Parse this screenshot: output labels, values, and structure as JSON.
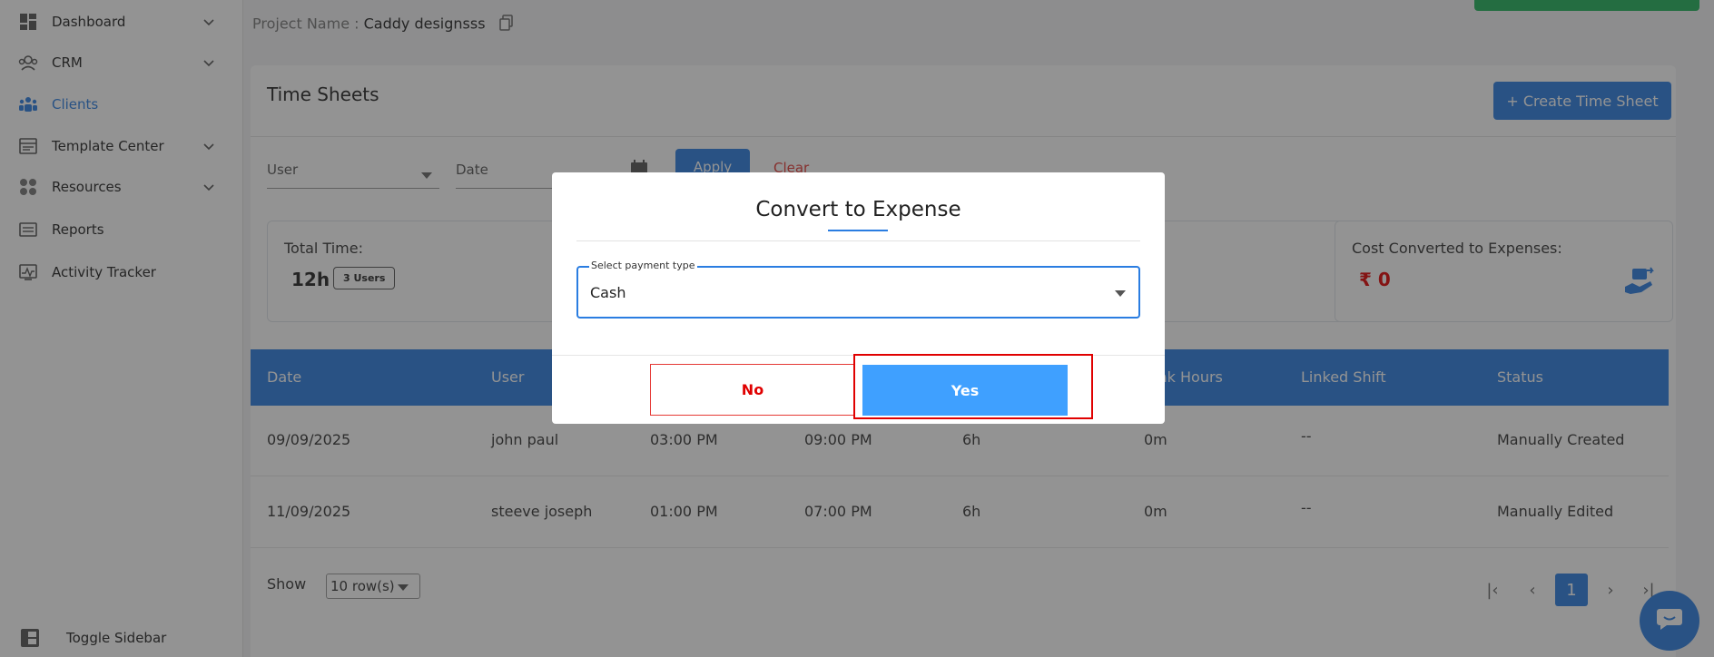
{
  "sidebar": {
    "items": [
      {
        "label": "Dashboard"
      },
      {
        "label": "CRM"
      },
      {
        "label": "Clients"
      },
      {
        "label": "Template Center"
      },
      {
        "label": "Resources"
      },
      {
        "label": "Reports"
      },
      {
        "label": "Activity Tracker"
      }
    ],
    "toggle_label": "Toggle Sidebar"
  },
  "header": {
    "project_label": "Project Name : ",
    "project_name": "Caddy designsss"
  },
  "main": {
    "title": "Time Sheets",
    "create_button": "+ Create Time Sheet",
    "filters": {
      "user_placeholder": "User",
      "date_placeholder": "Date",
      "apply": "Apply",
      "clear": "Clear"
    },
    "stats": {
      "total_time_label": "Total Time:",
      "total_time_value": "12h",
      "users_badge": "3 Users",
      "cost_label": "Cost Converted to Expenses:",
      "cost_value": "₹ 0"
    },
    "table": {
      "headers": [
        "Date",
        "User",
        "",
        "",
        "",
        "eak Hours",
        "Linked Shift",
        "Status"
      ],
      "rows": [
        [
          "09/09/2025",
          "john paul",
          "03:00 PM",
          "09:00 PM",
          "6h",
          "0m",
          "--",
          "Manually Created"
        ],
        [
          "11/09/2025",
          "steeve joseph",
          "01:00 PM",
          "07:00 PM",
          "6h",
          "0m",
          "--",
          "Manually Edited"
        ]
      ]
    },
    "pagination": {
      "show_label": "Show",
      "rows_value": "10 row(s)",
      "first": "|‹",
      "prev": "‹",
      "current": "1",
      "next": "›",
      "last": "›|"
    }
  },
  "modal": {
    "title": "Convert to Expense",
    "field_label": "Select payment type",
    "field_value": "Cash",
    "no": "No",
    "yes": "Yes"
  },
  "colors": {
    "primary": "#2a7de1",
    "yes_button": "#3fa0ff",
    "danger": "#e00000"
  }
}
